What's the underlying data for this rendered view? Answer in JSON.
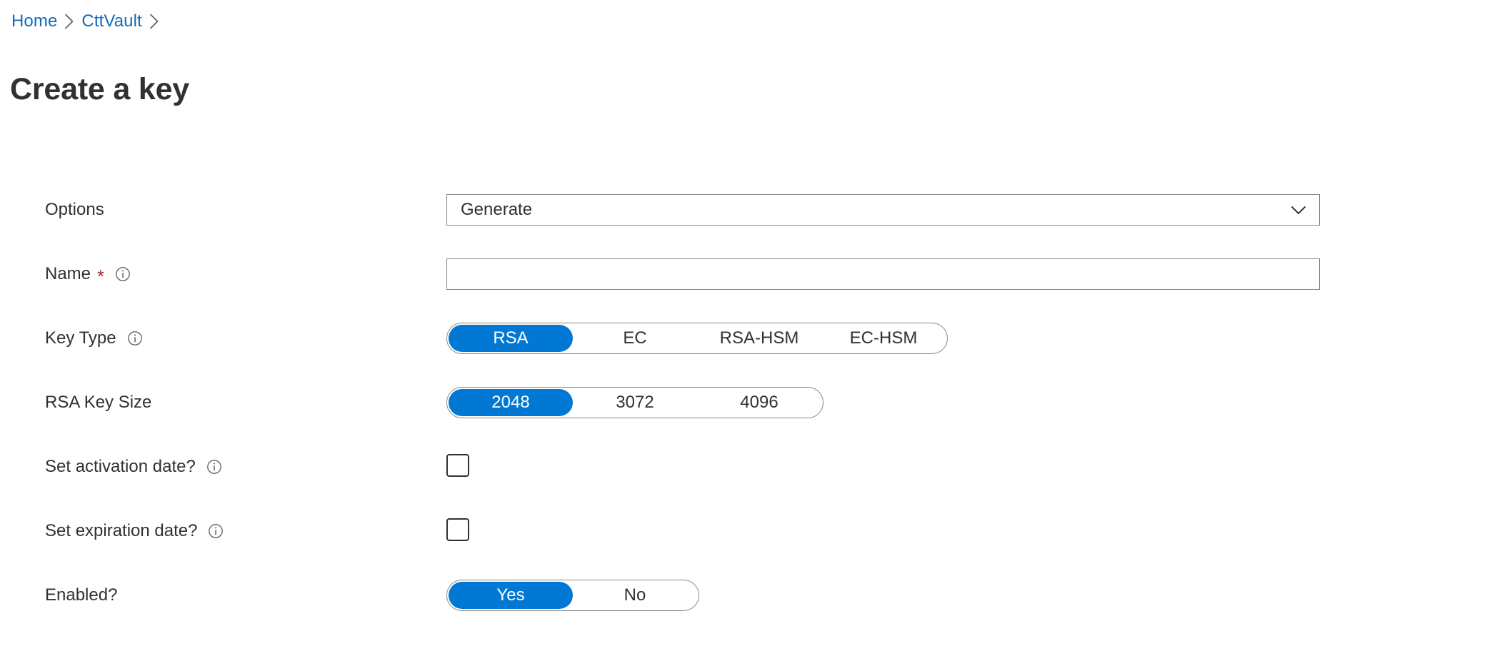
{
  "breadcrumb": {
    "items": [
      {
        "label": "Home"
      },
      {
        "label": "CttVault"
      }
    ],
    "separator_icon": "chevron-right-icon"
  },
  "header": {
    "title": "Create a key"
  },
  "colors": {
    "accent": "#0078d4",
    "link": "#0f6cbd",
    "text": "#323130",
    "border": "#8a8886",
    "required": "#a4262c"
  },
  "form": {
    "rows": [
      {
        "label": "Options",
        "required": false,
        "info": false,
        "control": "dropdown",
        "value": "Generate",
        "icon": "chevron-down-icon"
      },
      {
        "label": "Name",
        "required": true,
        "required_mark": "*",
        "info": true,
        "info_icon": "info-icon",
        "control": "text",
        "value": "",
        "placeholder": ""
      },
      {
        "label": "Key Type",
        "required": false,
        "info": true,
        "info_icon": "info-icon",
        "control": "choicegroup",
        "options": [
          "RSA",
          "EC",
          "RSA-HSM",
          "EC-HSM"
        ],
        "selected": "RSA"
      },
      {
        "label": "RSA Key Size",
        "required": false,
        "info": false,
        "control": "choicegroup",
        "options": [
          "2048",
          "3072",
          "4096"
        ],
        "selected": "2048"
      },
      {
        "label": "Set activation date?",
        "required": false,
        "info": true,
        "info_icon": "info-icon",
        "control": "checkbox",
        "checked": false
      },
      {
        "label": "Set expiration date?",
        "required": false,
        "info": true,
        "info_icon": "info-icon",
        "control": "checkbox",
        "checked": false
      },
      {
        "label": "Enabled?",
        "required": false,
        "info": false,
        "control": "choicegroup",
        "options": [
          "Yes",
          "No"
        ],
        "selected": "Yes"
      }
    ]
  }
}
